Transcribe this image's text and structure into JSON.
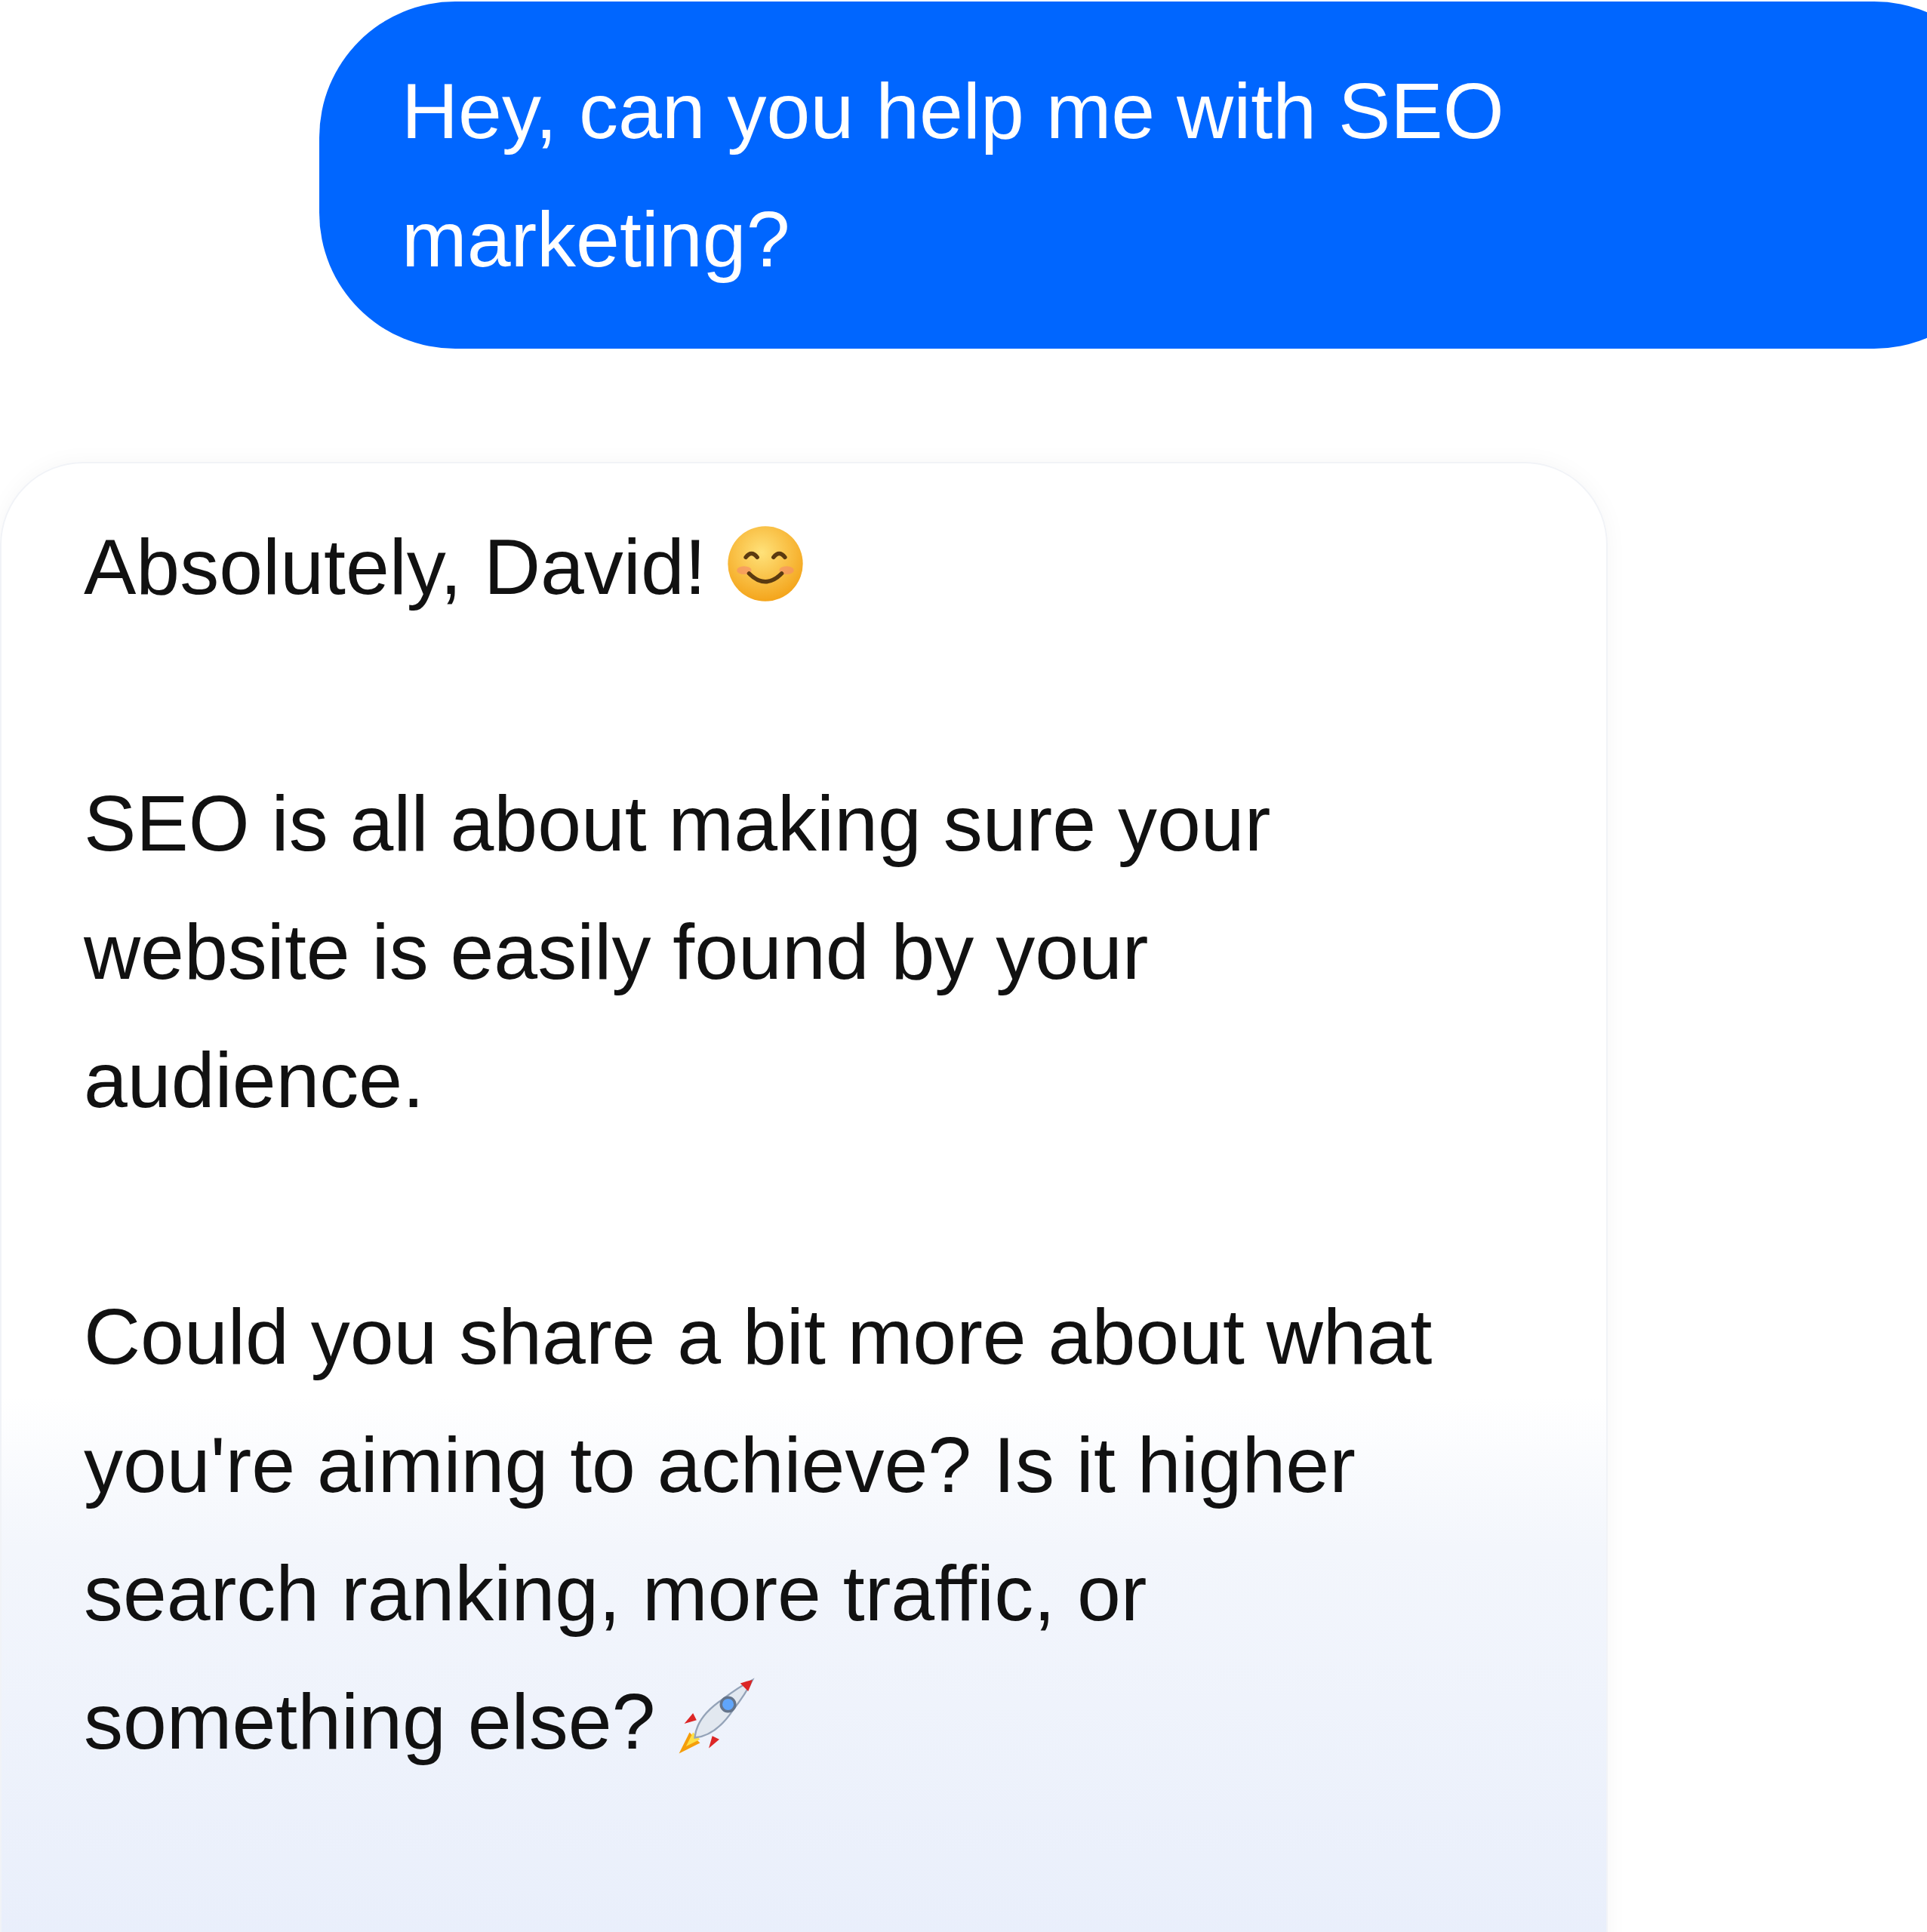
{
  "messages": [
    {
      "kind": "user",
      "paragraphs": [
        {
          "text": "Hey, can you help me with SEO marketing?"
        }
      ]
    },
    {
      "kind": "assistant",
      "paragraphs": [
        {
          "kind": "smiley",
          "text": "Absolutely, David!"
        },
        {
          "kind": "plain",
          "text": "SEO is all about making sure your website is easily found by your audience."
        },
        {
          "kind": "rocket",
          "text": "Could you share a bit more about what you're aiming to achieve? Is it higher search ranking, more traffic, or something else?"
        }
      ]
    }
  ]
}
